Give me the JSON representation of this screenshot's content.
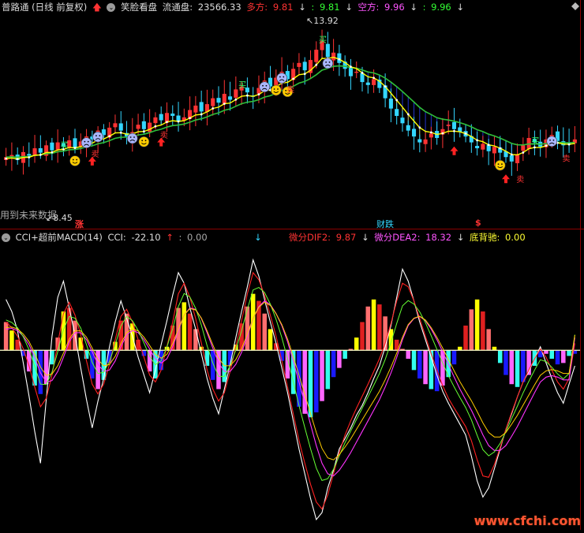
{
  "top_panel": {
    "title": "普路通 (日线 前复权)",
    "indicator_name": "笑脸看盘",
    "float_label": "流通盘:",
    "float_value": "23566.33",
    "long_label": "多方:",
    "long_value": "9.81",
    "long_value2": "9.81",
    "short_label": "空方:",
    "short_value": "9.96",
    "short_value2": "9.96",
    "high_label": "13.92",
    "low_label": "8.45",
    "future_note": "用到未来数据",
    "signal_zhang": "涨",
    "signal_caidie": "财跌",
    "signal_dollar": "$",
    "buy_label": "买",
    "sell_label": "卖"
  },
  "bottom_panel": {
    "indicator_name": "CCI+超前MACD(14)",
    "cci_label": "CCI:",
    "cci_value": "-22.10",
    "cci_value2": "0.00",
    "dif_label": "微分DIF2:",
    "dif_value": "9.87",
    "dea_label": "微分DEA2:",
    "dea_value": "18.32",
    "div_label": "底背驰:",
    "div_value": "0.00"
  },
  "watermark": "www.cfchi.com",
  "colors": {
    "up": "#ff3333",
    "down": "#33d6ff",
    "ma_yellow": "#ffff00",
    "ma_green": "#2fbf3a",
    "hist_pos_a": "#ff6f6f",
    "hist_pos_b": "#ffff00",
    "hist_pos_c": "#e02020",
    "hist_neg_a": "#1a1aff",
    "hist_neg_b": "#ff66ff",
    "hist_neg_c": "#33ffee",
    "cci": "#ffffff",
    "dif": "#ff2222",
    "dea": "#ff33ff",
    "label_red": "#ff3333",
    "label_green": "#33ff33",
    "label_magenta": "#ff55ff",
    "label_yellow": "#ffff33",
    "label_white": "#dddddd"
  },
  "chart_data": [
    {
      "type": "candlestick",
      "title": "普路通 (日线 前复权)",
      "ylim": [
        7.6,
        14.3
      ],
      "price_extremes": {
        "high": 13.92,
        "low": 8.45
      },
      "close": [
        9.55,
        9.62,
        9.45,
        9.72,
        9.6,
        9.85,
        9.7,
        9.95,
        9.78,
        10.05,
        9.9,
        10.12,
        9.85,
        10.08,
        10.25,
        10.15,
        10.45,
        10.3,
        10.55,
        10.7,
        10.45,
        10.25,
        10.4,
        10.65,
        10.5,
        10.72,
        10.9,
        10.8,
        11.05,
        10.95,
        10.75,
        10.9,
        11.15,
        11.3,
        11.1,
        11.35,
        11.55,
        11.4,
        11.7,
        11.5,
        11.85,
        11.95,
        11.75,
        11.6,
        11.9,
        12.15,
        11.95,
        12.25,
        12.45,
        12.2,
        12.55,
        12.75,
        12.5,
        12.85,
        13.2,
        13.5,
        12.95,
        13.1,
        12.75,
        12.55,
        12.3,
        12.45,
        12.1,
        12.0,
        12.2,
        11.9,
        11.55,
        11.2,
        10.95,
        10.7,
        10.45,
        10.25,
        10.05,
        10.15,
        10.35,
        10.2,
        10.5,
        10.65,
        10.5,
        10.4,
        10.25,
        10.05,
        9.85,
        10.0,
        9.75,
        9.9,
        9.7,
        9.55,
        9.4,
        9.65,
        9.95,
        10.2,
        10.05,
        9.9,
        10.15,
        10.3,
        10.1,
        9.95,
        10.0,
        10.15
      ]
    },
    {
      "type": "bar",
      "title": "CCI+超前MACD(14)",
      "series": [
        {
          "name": "CCI",
          "values": [
            72,
            55,
            28,
            -18,
            -65,
            -115,
            -160,
            -70,
            20,
            75,
            98,
            60,
            22,
            -25,
            -70,
            -110,
            -72,
            -40,
            5,
            40,
            70,
            45,
            20,
            -10,
            -35,
            -60,
            -28,
            8,
            42,
            78,
            110,
            95,
            60,
            30,
            -5,
            -40,
            -68,
            -90,
            -55,
            -20,
            18,
            55,
            90,
            128,
            105,
            72,
            40,
            10,
            -25,
            -60,
            -100,
            -140,
            -175,
            -210,
            -240,
            -230,
            -195,
            -170,
            -140,
            -125,
            -110,
            -92,
            -78,
            -60,
            -40,
            -22,
            5,
            35,
            75,
            115,
            98,
            70,
            40,
            15,
            -10,
            -35,
            -58,
            -75,
            -90,
            -105,
            -120,
            -150,
            -185,
            -208,
            -195,
            -168,
            -140,
            -112,
            -90,
            -66,
            -45,
            -30,
            -12,
            5,
            -18,
            -40,
            -60,
            -75,
            -48,
            -22.1
          ]
        },
        {
          "name": "微分DIF2",
          "values": [
            40,
            32,
            20,
            2,
            -22,
            -52,
            -80,
            -68,
            -35,
            10,
            52,
            68,
            50,
            22,
            -15,
            -48,
            -62,
            -48,
            -20,
            15,
            48,
            58,
            40,
            15,
            -10,
            -35,
            -45,
            -28,
            5,
            40,
            80,
            95,
            75,
            45,
            10,
            -28,
            -55,
            -72,
            -60,
            -30,
            5,
            42,
            80,
            110,
            100,
            78,
            50,
            20,
            -15,
            -52,
            -90,
            -128,
            -160,
            -190,
            -215,
            -225,
            -205,
            -175,
            -145,
            -120,
            -100,
            -82,
            -65,
            -48,
            -30,
            -12,
            10,
            38,
            70,
            95,
            90,
            70,
            45,
            20,
            -5,
            -28,
            -50,
            -68,
            -82,
            -95,
            -108,
            -128,
            -155,
            -178,
            -180,
            -162,
            -138,
            -112,
            -88,
            -66,
            -45,
            -28,
            -12,
            2,
            -10,
            -28,
            -45,
            -55,
            -40,
            9.87
          ]
        },
        {
          "name": "微分DEA2",
          "values": [
            30,
            31,
            28,
            20,
            8,
            -10,
            -32,
            -45,
            -43,
            -30,
            -10,
            12,
            25,
            25,
            15,
            -2,
            -20,
            -30,
            -28,
            -15,
            5,
            22,
            28,
            25,
            15,
            2,
            -12,
            -18,
            -12,
            5,
            28,
            50,
            60,
            58,
            45,
            25,
            3,
            -18,
            -30,
            -30,
            -20,
            -3,
            20,
            45,
            62,
            70,
            65,
            52,
            35,
            12,
            -15,
            -45,
            -75,
            -105,
            -135,
            -160,
            -175,
            -178,
            -170,
            -158,
            -145,
            -130,
            -115,
            -100,
            -85,
            -70,
            -52,
            -32,
            -10,
            15,
            35,
            45,
            48,
            42,
            30,
            15,
            -2,
            -20,
            -38,
            -55,
            -70,
            -85,
            -102,
            -120,
            -135,
            -142,
            -142,
            -135,
            -122,
            -108,
            -92,
            -76,
            -60,
            -45,
            -38,
            -36,
            -38,
            -42,
            -42,
            18.32
          ]
        },
        {
          "name": "MACD",
          "values": [
            40,
            28,
            15,
            -8,
            -30,
            -50,
            -62,
            -48,
            -20,
            18,
            55,
            60,
            42,
            18,
            -12,
            -40,
            -55,
            -42,
            -18,
            12,
            42,
            52,
            38,
            15,
            -8,
            -30,
            -40,
            -28,
            5,
            35,
            60,
            68,
            52,
            30,
            5,
            -22,
            -42,
            -55,
            -45,
            -22,
            8,
            38,
            62,
            80,
            70,
            52,
            30,
            10,
            -15,
            -40,
            -62,
            -80,
            -90,
            -95,
            -88,
            -72,
            -55,
            -38,
            -25,
            -12,
            2,
            18,
            40,
            62,
            72,
            65,
            48,
            30,
            15,
            2,
            -12,
            -28,
            -40,
            -48,
            -55,
            -58,
            -50,
            -38,
            -20,
            5,
            35,
            58,
            72,
            55,
            30,
            5,
            -18,
            -35,
            -48,
            -52,
            -45,
            -35,
            -22,
            -10,
            -5,
            -12,
            -20,
            -18,
            -8,
            -5
          ]
        }
      ],
      "ylim": [
        -250,
        150
      ],
      "zero_line": true
    }
  ]
}
